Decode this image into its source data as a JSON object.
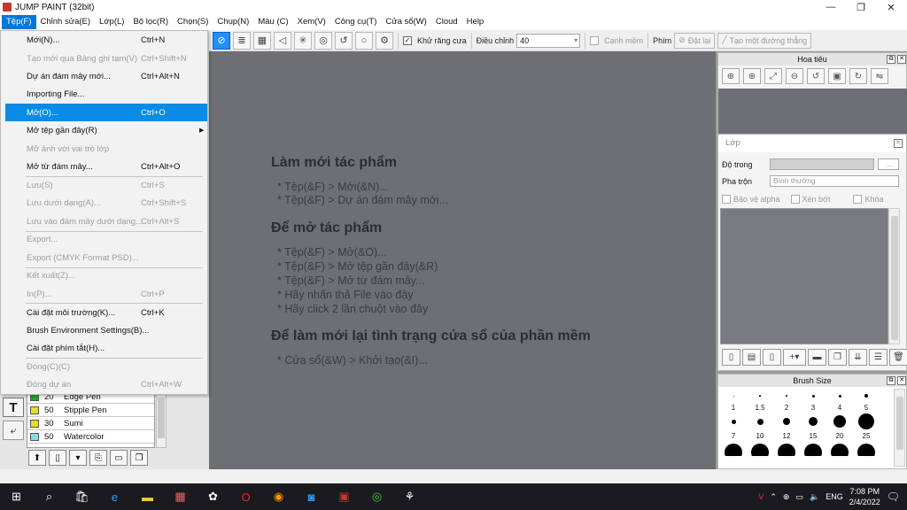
{
  "window": {
    "title": "JUMP PAINT (32bit)",
    "minimize": "—",
    "maximize": "❐",
    "close": "✕"
  },
  "menubar": [
    "Tệp(F)",
    "Chỉnh sửa(E)",
    "Lớp(L)",
    "Bộ lọc(R)",
    "Chọn(S)",
    "Chụp(N)",
    "Màu (C)",
    "Xem(V)",
    "Công cụ(T)",
    "Cửa sổ(W)",
    "Cloud",
    "Help"
  ],
  "toolbar": {
    "antialias_label": "Khử răng cưa",
    "adjust_label": "Điều chỉnh",
    "adjust_value": "40",
    "edge_label": "Cạnh mềm",
    "key_label": "Phím",
    "reset_label": "Đặt lại",
    "line_label": "Tạo một đường thẳng"
  },
  "file_menu": {
    "items": [
      {
        "label": "Mới(N)...",
        "shortcut": "Ctrl+N"
      },
      {
        "label": "Tạo mới qua Bảng ghi tạm(V)",
        "shortcut": "Ctrl+Shift+N"
      },
      {
        "label": "Dự án đám mây mới...",
        "shortcut": "Ctrl+Alt+N"
      },
      {
        "label": "Importing File...",
        "shortcut": ""
      },
      {
        "label": "Mở(O)...",
        "shortcut": "Ctrl+O"
      },
      {
        "label": "Mở tệp gần đây(R)",
        "shortcut": ""
      },
      {
        "label": "Mở ảnh với vai trò lớp",
        "shortcut": ""
      },
      {
        "label": "Mở từ đám mây...",
        "shortcut": "Ctrl+Alt+O"
      },
      {
        "label": "Lưu(S)",
        "shortcut": "Ctrl+S"
      },
      {
        "label": "Lưu dưới dạng(A)...",
        "shortcut": "Ctrl+Shift+S"
      },
      {
        "label": "Lưu vào đám mây dưới dạng...",
        "shortcut": "Ctrl+Alt+S"
      },
      {
        "label": "Export...",
        "shortcut": ""
      },
      {
        "label": "Export (CMYK Format PSD)...",
        "shortcut": ""
      },
      {
        "label": "Kết xuất(Z)...",
        "shortcut": ""
      },
      {
        "label": "In(P)...",
        "shortcut": "Ctrl+P"
      },
      {
        "label": "Cài đặt môi trường(K)...",
        "shortcut": "Ctrl+K"
      },
      {
        "label": "Brush Environment Settings(B)...",
        "shortcut": ""
      },
      {
        "label": "Cài đặt phím tắt(H)...",
        "shortcut": ""
      },
      {
        "label": "Đóng(C)(C)",
        "shortcut": ""
      },
      {
        "label": "Đóng dự án",
        "shortcut": "Ctrl+Alt+W"
      }
    ]
  },
  "canvas": {
    "new_heading": "Làm mới tác phẩm",
    "new_lines": [
      "* Tệp(&F) > Mới(&N)...",
      "* Tệp(&F) > Dự án đám mây mới..."
    ],
    "open_heading": "Để mở tác phẩm",
    "open_lines": [
      "* Tệp(&F) > Mở(&O)...",
      "* Tệp(&F) > Mở tệp gần đây(&R)",
      "* Tệp(&F) > Mở từ đám mây...",
      "* Hãy nhấn thả File vào đây",
      "* Hãy click 2 lần chuột vào đây"
    ],
    "reset_heading": "Để làm mới lại tình trạng cửa sổ của phần mềm",
    "reset_lines": [
      "* Cửa sổ(&W) > Khởi tạo(&I)..."
    ]
  },
  "brushes": [
    {
      "size": "20",
      "name": "Edge Pen",
      "color": "#22aa22"
    },
    {
      "size": "50",
      "name": "Stipple Pen",
      "color": "#e8e020"
    },
    {
      "size": "30",
      "name": "Sumi",
      "color": "#e8e020"
    },
    {
      "size": "50",
      "name": "Watercolor",
      "color": "#88d8f0"
    }
  ],
  "navigator": {
    "title": "Hoa tiêu"
  },
  "layer_panel": {
    "title": "Lớp",
    "opacity_label": "Độ trong",
    "blend_label": "Pha trộn",
    "blend_value": "Bình thường",
    "protect_alpha": "Bảo vệ alpha",
    "clipping": "Xén bớt",
    "lock": "Khóa"
  },
  "brush_size": {
    "title": "Brush Size",
    "labels_row1": [
      "1",
      "1.5",
      "2",
      "3",
      "4",
      "5"
    ],
    "labels_row2": [
      "7",
      "10",
      "12",
      "15",
      "20",
      "25"
    ]
  },
  "taskbar": {
    "language": "ENG",
    "time": "7:08 PM",
    "date": "2/4/2022"
  }
}
